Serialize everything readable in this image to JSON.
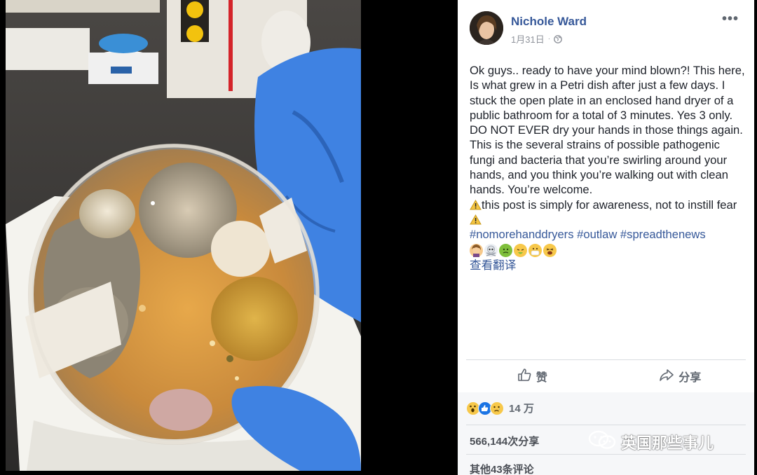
{
  "post": {
    "author": "Nichole Ward",
    "date": "1月31日",
    "body_lines": [
      "Ok guys.. ready to have your mind blown?! This here, Is what grew in a Petri dish after just a few days. I stuck the open plate in an enclosed hand dryer of a public bathroom for a total of 3 minutes. Yes 3 only. DO NOT EVER dry your hands in those things again. This is the several strains of possible pathogenic fungi and bacteria that you’re swirling around your hands, and you think you’re walking out with clean hands. You’re welcome."
    ],
    "awareness_text": "this post is simply for awareness, not to instill fear",
    "hashtags": "#nomorehanddryers #outlaw #spreadthenews",
    "emoji_names": [
      "woman-facepalm-emoji",
      "skull-crossbones-emoji",
      "nauseated-face-emoji",
      "vomiting-face-emoji",
      "mask-face-emoji",
      "tired-face-emoji"
    ],
    "see_translation": "查看翻译"
  },
  "actions": {
    "like_label": "赞",
    "share_label": "分享"
  },
  "stats": {
    "reactions_count": "14 万",
    "reaction_icons": [
      "wow-reaction-icon",
      "like-reaction-icon",
      "sad-reaction-icon"
    ],
    "shares": "566,144次分享",
    "comments": "其他43条评论"
  },
  "watermark": {
    "text": "英国那些事儿"
  },
  "colors": {
    "link_blue": "#365899",
    "text": "#1d2129",
    "muted": "#90949c",
    "panel_bg": "#ffffff",
    "gray_bg": "#f6f7f9",
    "glove_blue": "#3d7fe0"
  }
}
